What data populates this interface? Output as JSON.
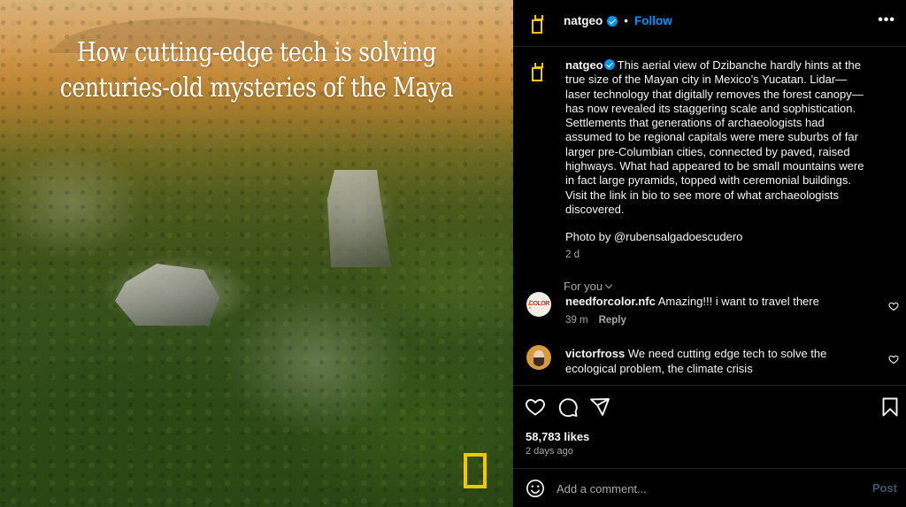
{
  "photo": {
    "title_lines": [
      "How cutting-edge tech is solving",
      "centuries-old mysteries of the Maya"
    ],
    "logo": "natgeo-yellow-border-logo",
    "description": "Aerial view of Maya temple ruins rising above dense jungle canopy at sunset"
  },
  "header": {
    "username": "natgeo",
    "verified": true,
    "separator": "•",
    "follow_label": "Follow",
    "more_label": "•••"
  },
  "caption": {
    "username": "natgeo",
    "text": "This aerial view of Dzibanche hardly hints at the true size of the Mayan city in Mexico’s Yucatan. Lidar—laser technology that digitally removes the forest canopy—has now revealed its staggering scale and sophistication. Settlements that generations of archaeologists had assumed to be regional capitals were mere suburbs of far larger pre-Columbian cities, connected by paved, raised highways. What had appeared to be small mountains were in fact large pyramids, topped with ceremonial buildings. Visit the link in bio to see more of what archaeologists discovered.",
    "credit": "Photo by @rubensalgadoescudero",
    "age": "2 d"
  },
  "filter": {
    "label": "For you"
  },
  "comments": [
    {
      "username": "needforcolor.nfc",
      "text": "Amazing!!! i want to travel there",
      "age": "39 m",
      "reply_label": "Reply"
    },
    {
      "username": "victorfross",
      "text": "We need cutting edge tech to solve the ecological problem, the climate crisis",
      "age": "",
      "reply_label": ""
    }
  ],
  "actions": {
    "icons": [
      "heart-icon",
      "comment-icon",
      "share-icon",
      "bookmark-icon"
    ],
    "likes": "58,783 likes",
    "posted": "2 days ago"
  },
  "add_comment": {
    "placeholder": "Add a comment...",
    "post_label": "Post"
  },
  "colors": {
    "accent": "#0095f6",
    "natgeo_yellow": "#f7c600",
    "background": "#000000",
    "muted_text": "#a8a8a8",
    "post_disabled": "#3b5670"
  }
}
